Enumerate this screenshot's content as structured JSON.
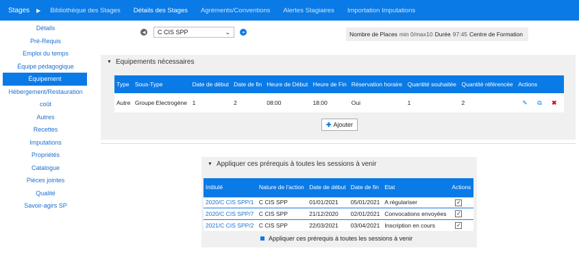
{
  "topnav": {
    "brand": "Stages",
    "items": [
      "Bibliothèque des Stages",
      "Détails des Stages",
      "Agréments/Conventions",
      "Alertes Stagiaires",
      "Importation Imputations"
    ]
  },
  "sidebar": {
    "items": [
      "Détails",
      "Pré-Requis",
      "Emploi du temps",
      "Équipe pédagogique",
      "Équipement",
      "Hébergement/Restauration",
      "coût",
      "Autres",
      "Recettes",
      "Imputations",
      "Propriétés",
      "Catalogue",
      "Pièces jointes",
      "Qualité",
      "Savoir-agirs SP"
    ]
  },
  "selector": {
    "value": "C CIS SPP"
  },
  "info": {
    "places_label": "Nombre de Places",
    "places_value": "min 0/max10",
    "duree_label": "Durée",
    "duree_value": "97:45",
    "centre_label": "Centre de Formation"
  },
  "equipements": {
    "title": "Equipements nécessaires",
    "headers": [
      "Type",
      "Sous-Type",
      "Date de début",
      "Date de fin",
      "Heure de Début",
      "Heure de Fin",
      "Réservation horaire",
      "Quantité souhaitée",
      "Quantité référencée",
      "Actions"
    ],
    "rows": [
      [
        "Autre",
        "Groupe Electrogène",
        "1",
        "2",
        "08:00",
        "18:00",
        "Oui",
        "1",
        "2"
      ]
    ],
    "add_label": "Ajouter"
  },
  "sessions": {
    "title": "Appliquer ces prérequis à toutes les sessions à venir",
    "headers": [
      "Intitulé",
      "Nature de l'action",
      "Date de début",
      "Date de fin",
      "Etat",
      "Actions"
    ],
    "rows": [
      [
        "2020/C CIS SPP/1",
        "C CIS SPP",
        "01/01/2021",
        "05/01/2021",
        "A régulariser"
      ],
      [
        "2020/C CIS SPP/7",
        "C CIS SPP",
        "21/12/2020",
        "02/01/2021",
        "Convocations envoyées"
      ],
      [
        "2021/C CIS SPP/2",
        "C CIS SPP",
        "22/03/2021",
        "03/04/2021",
        "Inscription en cours"
      ]
    ],
    "footnote": "Appliquer ces prérequis à toutes les sessions à venir"
  },
  "colors": {
    "accent": "#0a7ae6",
    "link": "#1a6fd1",
    "danger": "#dd1111"
  }
}
